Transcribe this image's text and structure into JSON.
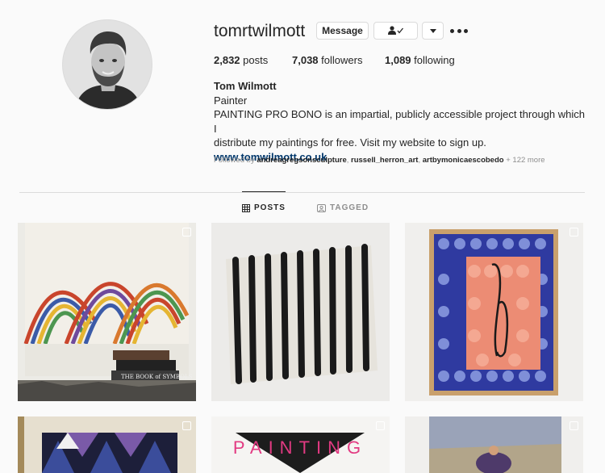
{
  "profile": {
    "username": "tomrtwilmott",
    "full_name": "Tom Wilmott",
    "category": "Painter",
    "bio_lines": [
      "PAINTING PRO BONO is an impartial, publicly accessible project through which I",
      "distribute my paintings for free. Visit my website to sign up."
    ],
    "website": "www.tomwilmott.co.uk"
  },
  "buttons": {
    "message": "Message",
    "following_icon": "person-check-icon",
    "dropdown_icon": "chevron-down-icon",
    "more_icon": "more-dots-icon"
  },
  "stats": {
    "posts_count": "2,832",
    "posts_label": " posts",
    "followers_count": "7,038",
    "followers_label": " followers",
    "following_count": "1,089",
    "following_label": " following"
  },
  "followed_by": {
    "prefix": "Followed by ",
    "accounts": [
      "andreagregsonsculpture",
      "russell_herron_art",
      "artbymonicaescobedo"
    ],
    "suffix": " + 122 more"
  },
  "tabs": [
    {
      "label": "POSTS",
      "icon": "grid-icon",
      "active": true
    },
    {
      "label": "TAGGED",
      "icon": "tagged-icon",
      "active": false
    }
  ],
  "posts_text": {
    "book_title": "THE BOOK of SYMBOLS",
    "painting_word": "PAINTING"
  },
  "colors": {
    "accent_link": "#00376b",
    "muted": "#8e8e8e",
    "border": "#dbdbdb"
  }
}
